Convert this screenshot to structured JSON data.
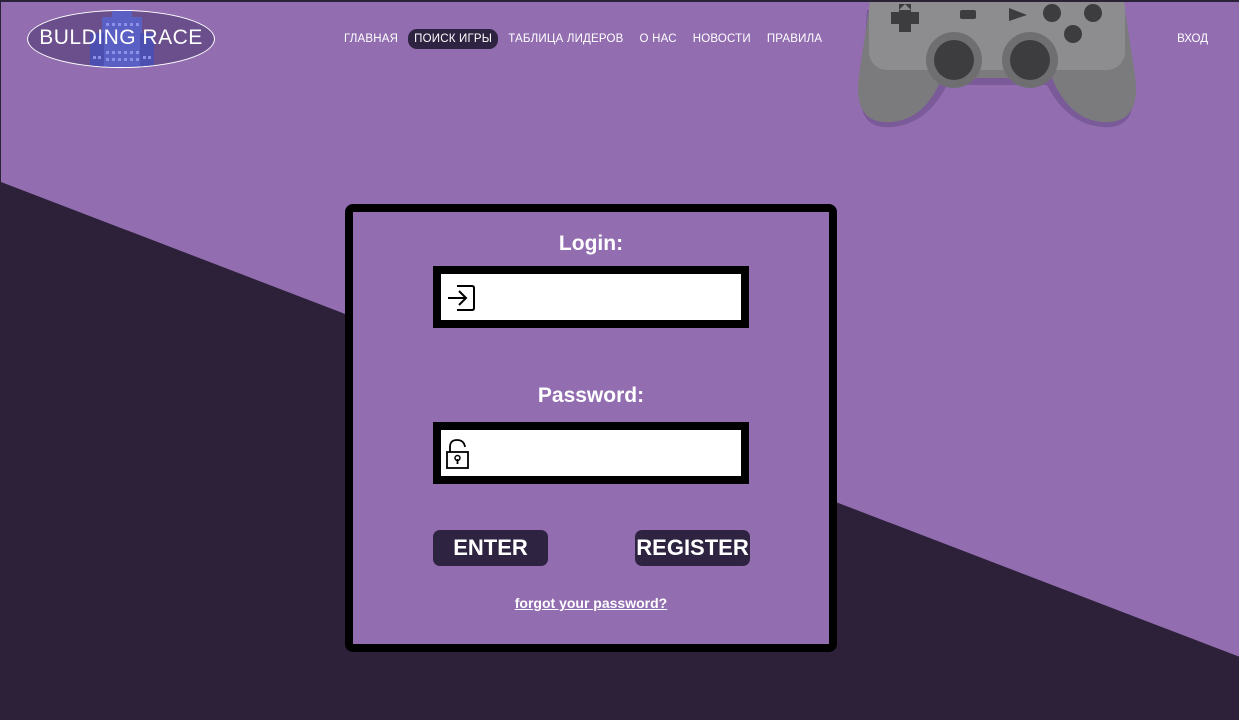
{
  "header": {
    "logo_text": "BULDING RACE",
    "nav": [
      {
        "label": "ГЛАВНАЯ"
      },
      {
        "label": "ПОИСК ИГРЫ"
      },
      {
        "label": "ТАБЛИЦА ЛИДЕРОВ"
      },
      {
        "label": "О НАС"
      },
      {
        "label": "НОВОСТИ"
      },
      {
        "label": "ПРАВИЛА"
      }
    ],
    "active_nav": "ПОИСК ИГРЫ",
    "login_link": "ВХОД"
  },
  "login_form": {
    "login_label": "Login:",
    "login_value": "",
    "login_icon": "sign-in-arrow-icon",
    "password_label": "Password:",
    "password_value": "",
    "password_icon": "unlocked-padlock-icon",
    "enter_button": "ENTER",
    "register_button": "REGISTER",
    "forgot_link": "forgot your password?"
  },
  "decor": {
    "gamepad_icon": "gamepad-icon"
  },
  "colors": {
    "background_purple": "#926db0",
    "background_dark": "#2c2139",
    "button_dark": "#2e2340",
    "card_border": "#000000"
  }
}
